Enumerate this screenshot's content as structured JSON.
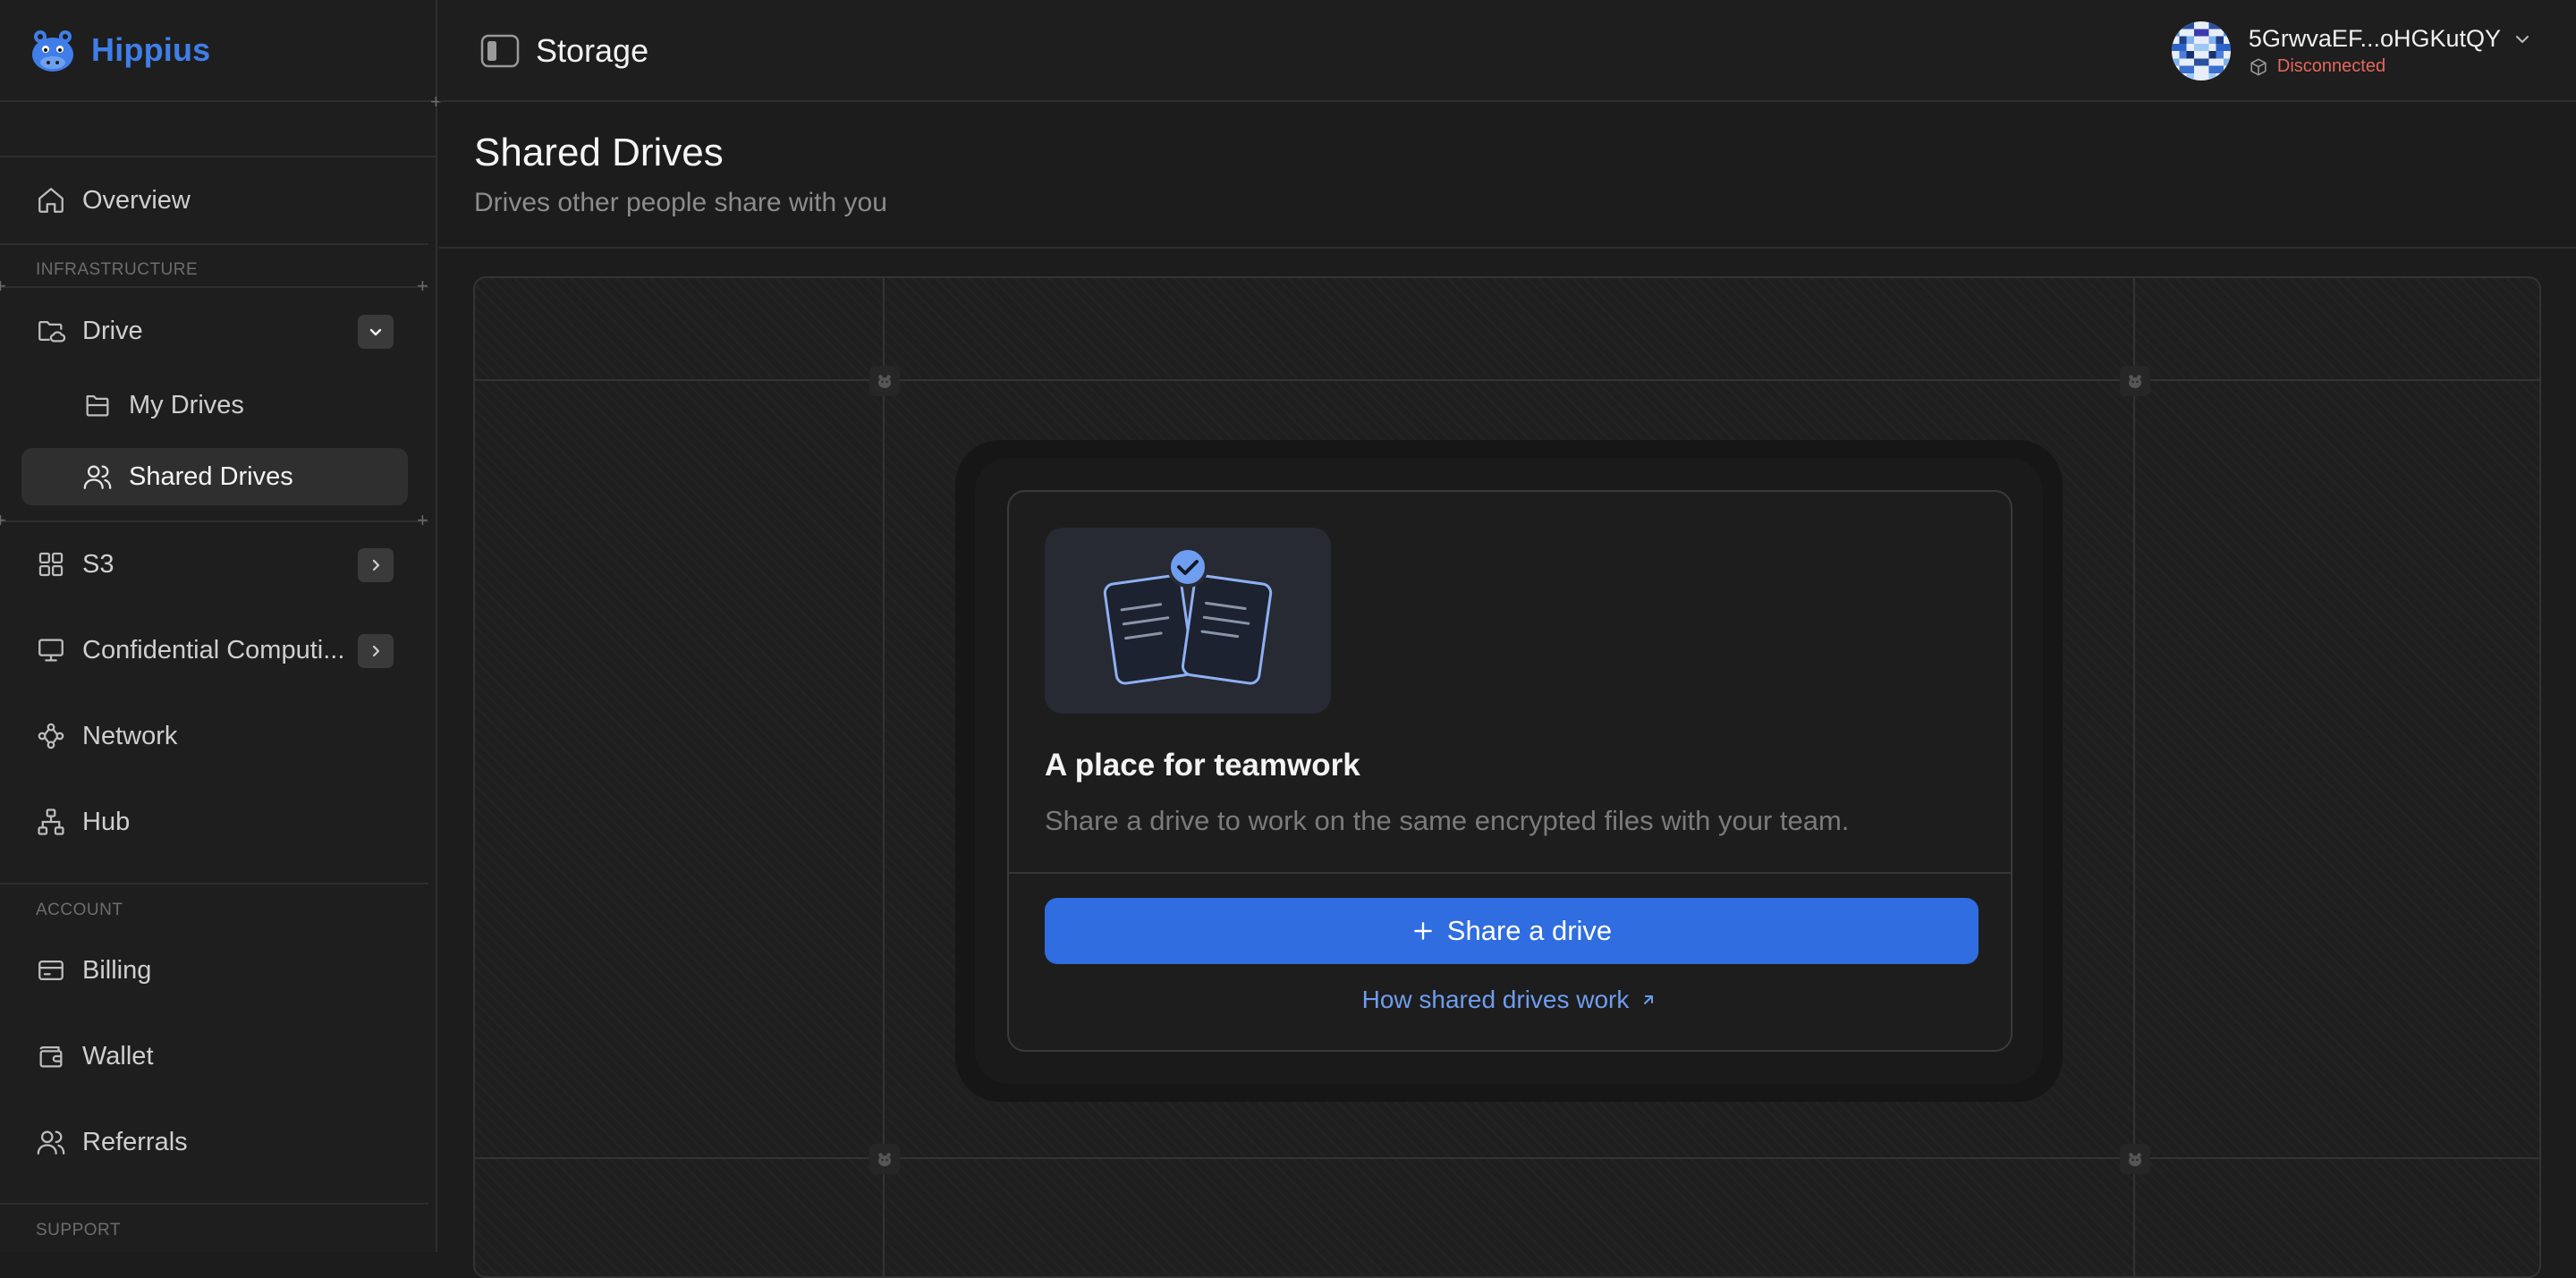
{
  "brand": {
    "name": "Hippius"
  },
  "topbar": {
    "context_title": "Storage"
  },
  "account": {
    "address": "5GrwvaEF...oHGKutQY",
    "status": "Disconnected",
    "status_color": "#e5675d"
  },
  "sidebar": {
    "overview": "Overview",
    "sections": {
      "infrastructure": "INFRASTRUCTURE",
      "account": "ACCOUNT",
      "support": "SUPPORT"
    },
    "drive": {
      "label": "Drive",
      "expanded": true,
      "children": {
        "my_drives": "My Drives",
        "shared_drives": "Shared Drives"
      }
    },
    "s3": "S3",
    "confidential": "Confidential Computi...",
    "network": "Network",
    "hub": "Hub",
    "billing": "Billing",
    "wallet": "Wallet",
    "referrals": "Referrals",
    "active_item": "Shared Drives"
  },
  "page": {
    "title": "Shared Drives",
    "subtitle": "Drives other people share with you"
  },
  "empty_state": {
    "title": "A place for teamwork",
    "description": "Share a drive to work on the same encrypted files with your team.",
    "primary_button": "Share a drive",
    "help_link": "How shared drives work"
  },
  "colors": {
    "accent": "#2f6de0",
    "brand": "#3f7ee8",
    "link": "#6f9df0"
  }
}
